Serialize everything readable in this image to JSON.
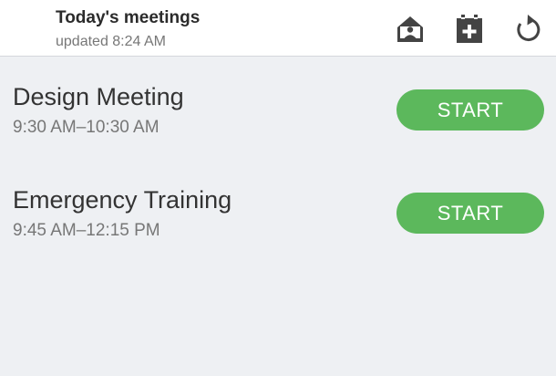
{
  "header": {
    "title": "Today's meetings",
    "subtitle": "updated 8:24 AM",
    "icons": [
      "room-display-icon",
      "add-meeting-icon",
      "refresh-icon"
    ]
  },
  "meetings": [
    {
      "title": "Design Meeting",
      "time": "9:30 AM–10:30 AM",
      "action": "START"
    },
    {
      "title": "Emergency Training",
      "time": "9:45 AM–12:15 PM",
      "action": "START"
    }
  ],
  "colors": {
    "accent": "#5cb85c",
    "icon": "#444444",
    "background": "#eef0f3",
    "header_bg": "#ffffff"
  }
}
